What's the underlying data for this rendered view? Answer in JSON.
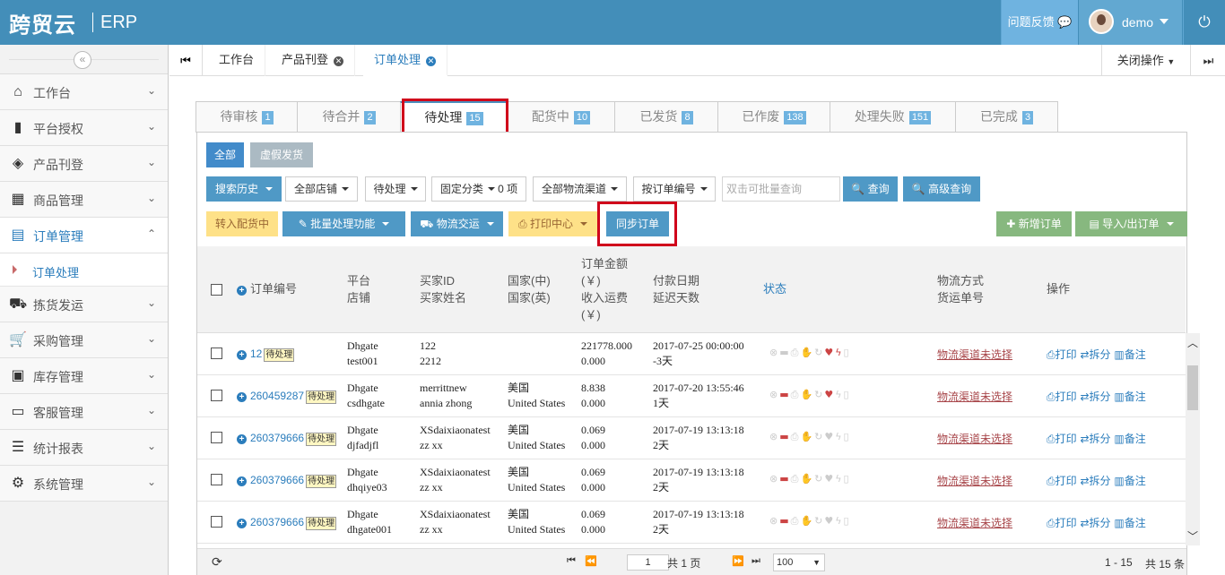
{
  "header": {
    "logo": "跨贸云",
    "product": "ERP",
    "feedback": "问题反馈",
    "username": "demo"
  },
  "sidebar": {
    "items": [
      {
        "label": "工作台",
        "icon": "home-icon"
      },
      {
        "label": "平台授权",
        "icon": "bookmark-icon"
      },
      {
        "label": "产品刊登",
        "icon": "cube-icon"
      },
      {
        "label": "商品管理",
        "icon": "gift-icon"
      },
      {
        "label": "订单管理",
        "icon": "file-icon"
      },
      {
        "label": "拣货发运",
        "icon": "truck-icon"
      },
      {
        "label": "采购管理",
        "icon": "cart-icon"
      },
      {
        "label": "库存管理",
        "icon": "inbox-icon"
      },
      {
        "label": "客服管理",
        "icon": "briefcase-icon"
      },
      {
        "label": "统计报表",
        "icon": "list-icon"
      },
      {
        "label": "系统管理",
        "icon": "gear-icon"
      }
    ],
    "sub_active": "订单处理"
  },
  "page_tabs": [
    {
      "label": "工作台"
    },
    {
      "label": "产品刊登"
    },
    {
      "label": "订单处理"
    }
  ],
  "close_ops": "关闭操作",
  "status_tabs": [
    {
      "label": "待审核",
      "count": "1"
    },
    {
      "label": "待合并",
      "count": "2"
    },
    {
      "label": "待处理",
      "count": "15"
    },
    {
      "label": "配货中",
      "count": "10"
    },
    {
      "label": "已发货",
      "count": "8"
    },
    {
      "label": "已作废",
      "count": "138"
    },
    {
      "label": "处理失败",
      "count": "151"
    },
    {
      "label": "已完成",
      "count": "3"
    }
  ],
  "filters": {
    "all": "全部",
    "fake": "虚假发货",
    "history": "搜索历史",
    "shop": "全部店铺",
    "status": "待处理",
    "fixed": "固定分类",
    "fixed_count": "0 项",
    "channel": "全部物流渠道",
    "by": "按订单编号",
    "search_placeholder": "双击可批量查询",
    "query": "查询",
    "advanced": "高级查询"
  },
  "actions": {
    "to_alloc": "转入配货中",
    "batch": "批量处理功能",
    "logistics": "物流交运",
    "print": "打印中心",
    "sync": "同步订单",
    "add": "新增订单",
    "import": "导入/出订单"
  },
  "columns": {
    "order": "订单编号",
    "platform": "平台",
    "shop": "店铺",
    "buyer_id": "买家ID",
    "buyer_name": "买家姓名",
    "country_cn": "国家(中)",
    "country_en": "国家(英)",
    "amount1": "订单金额",
    "amount2": "(￥)",
    "amount3": "收入运费",
    "amount4": "(￥)",
    "pay": "付款日期",
    "delay": "延迟天数",
    "state": "状态",
    "ship": "物流方式",
    "track": "货运单号",
    "ops": "操作"
  },
  "rows": [
    {
      "id": "12",
      "badge": "待处理",
      "platform": "Dhgate",
      "shop": "test001",
      "buyer_id": "122",
      "buyer_name": "2212",
      "cn": "",
      "en": "",
      "amount": "221778.000",
      "freight": "0.000",
      "date": "2017-07-25 00:00:00",
      "delay": "-3天",
      "ship": "物流渠道未选择"
    },
    {
      "id": "260459287",
      "badge": "待处理",
      "platform": "Dhgate",
      "shop": "csdhgate",
      "buyer_id": "merrittnew",
      "buyer_name": "annia zhong",
      "cn": "美国",
      "en": "United States",
      "amount": "8.838",
      "freight": "0.000",
      "date": "2017-07-20 13:55:46",
      "delay": "1天",
      "ship": "物流渠道未选择"
    },
    {
      "id": "260379666",
      "badge": "待处理",
      "platform": "Dhgate",
      "shop": "djfadjfl",
      "buyer_id": "XSdaixiaonatest",
      "buyer_name": "zz xx",
      "cn": "美国",
      "en": "United States",
      "amount": "0.069",
      "freight": "0.000",
      "date": "2017-07-19 13:13:18",
      "delay": "2天",
      "ship": "物流渠道未选择"
    },
    {
      "id": "260379666",
      "badge": "待处理",
      "platform": "Dhgate",
      "shop": "dhqiye03",
      "buyer_id": "XSdaixiaonatest",
      "buyer_name": "zz xx",
      "cn": "美国",
      "en": "United States",
      "amount": "0.069",
      "freight": "0.000",
      "date": "2017-07-19 13:13:18",
      "delay": "2天",
      "ship": "物流渠道未选择"
    },
    {
      "id": "260379666",
      "badge": "待处理",
      "platform": "Dhgate",
      "shop": "dhgate001",
      "buyer_id": "XSdaixiaonatest",
      "buyer_name": "zz xx",
      "cn": "美国",
      "en": "United States",
      "amount": "0.069",
      "freight": "0.000",
      "date": "2017-07-19 13:13:18",
      "delay": "2天",
      "ship": "物流渠道未选择"
    }
  ],
  "row_ops": {
    "print": "打印",
    "split": "拆分",
    "note": "备注"
  },
  "footer": {
    "page": "1",
    "total_pages": "共 1 页",
    "page_size": "100",
    "range": "1 - 15",
    "total": "共 15 条"
  }
}
